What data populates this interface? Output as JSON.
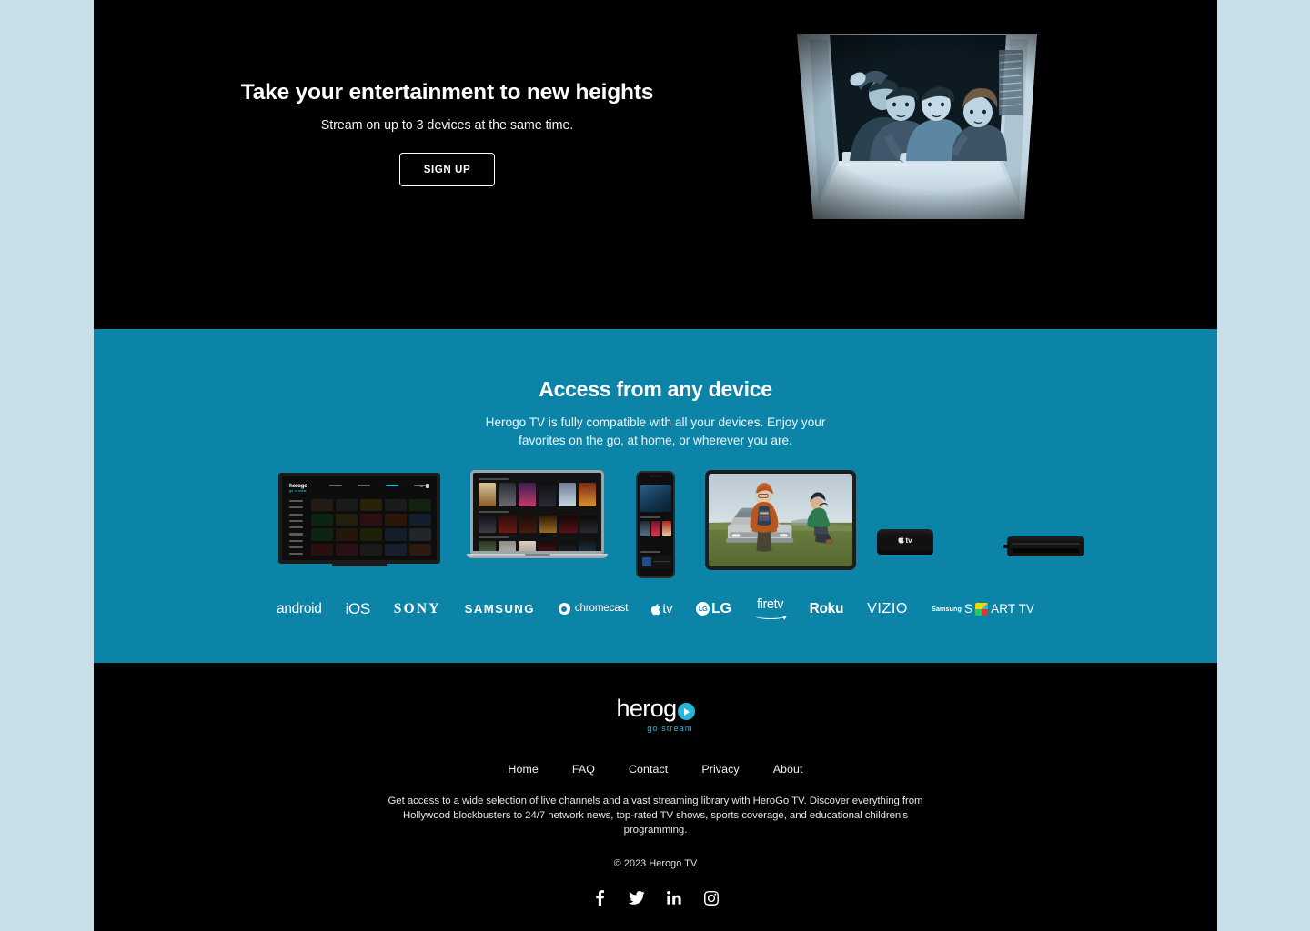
{
  "theme": {
    "page_bg": "#c9dfe7",
    "dark_bg": "#000000",
    "accent_blue": "#0b84a8",
    "logo_teal": "#25b6d8",
    "text_white": "#ffffff"
  },
  "hero": {
    "title": "Take your entertainment to new heights",
    "subtitle": "Stream on up to 3 devices at the same time.",
    "cta_label": "SIGN UP",
    "image_alt": "Four people looking down through an open window frame, blue-tinted night scene"
  },
  "devices_section": {
    "title": "Access from any device",
    "description": "Herogo TV is fully compatible with all your devices. Enjoy your favorites on the go, at home, or wherever you are.",
    "device_mockups": [
      {
        "name": "smart-tv",
        "screen_alt": "Herogo TV app channel grid on a television"
      },
      {
        "name": "laptop",
        "screen_alt": "Herogo TV movie poster rows on a laptop"
      },
      {
        "name": "phone",
        "screen_alt": "Herogo TV mobile app"
      },
      {
        "name": "tablet",
        "screen_alt": "Two people sitting on a truck in a grassy field"
      },
      {
        "name": "apple-tv-box",
        "screen_alt": "Apple TV streaming box"
      },
      {
        "name": "streaming-box",
        "screen_alt": "Set-top streaming box"
      }
    ],
    "brands": [
      {
        "id": "android",
        "label": "android"
      },
      {
        "id": "ios",
        "label": "iOS"
      },
      {
        "id": "sony",
        "label": "SONY"
      },
      {
        "id": "samsung",
        "label": "SAMSUNG"
      },
      {
        "id": "chromecast",
        "label": "chromecast"
      },
      {
        "id": "apple-tv",
        "label": "tv"
      },
      {
        "id": "lg",
        "label": "LG"
      },
      {
        "id": "fire-tv",
        "label": "firetv"
      },
      {
        "id": "roku",
        "label": "Roku"
      },
      {
        "id": "vizio",
        "label": "VIZIO"
      },
      {
        "id": "samsung-smart-tv",
        "label": "ART TV",
        "prefix": "Samsung",
        "lead": "S"
      }
    ]
  },
  "footer": {
    "logo_text": "herog",
    "logo_tagline": "go stream",
    "nav": [
      {
        "label": "Home"
      },
      {
        "label": "FAQ"
      },
      {
        "label": "Contact"
      },
      {
        "label": "Privacy"
      },
      {
        "label": "About"
      }
    ],
    "description": "Get access to a wide selection of live channels and a vast streaming library with HeroGo TV.  Discover everything from Hollywood blockbusters to 24/7 network news, top-rated TV shows, sports coverage, and educational children's programming.",
    "copyright": "© 2023 Herogo TV",
    "social": [
      {
        "id": "facebook",
        "label": "f"
      },
      {
        "id": "twitter",
        "label": ""
      },
      {
        "id": "linkedin",
        "label": "in"
      },
      {
        "id": "instagram",
        "label": ""
      }
    ]
  }
}
